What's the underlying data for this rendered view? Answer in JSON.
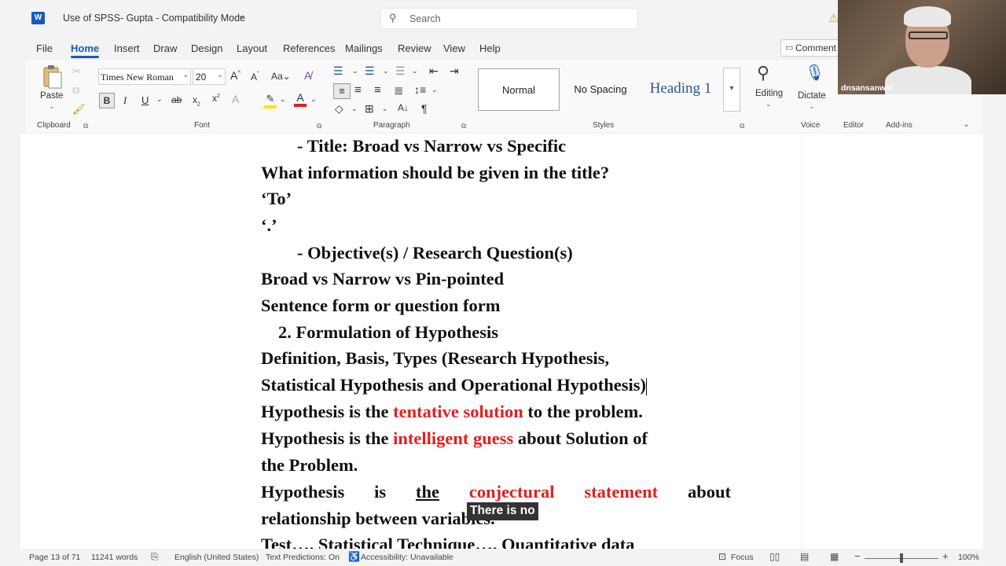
{
  "titlebar": {
    "app_icon": "W",
    "doc_title": "Use of SPSS- Gupta  -  Compatibility Mode",
    "search_placeholder": "Search"
  },
  "menu": {
    "tabs": [
      "File",
      "Home",
      "Insert",
      "Draw",
      "Design",
      "Layout",
      "References",
      "Mailings",
      "Review",
      "View",
      "Help"
    ],
    "active": "Home",
    "comments_label": "Comment"
  },
  "ribbon": {
    "paste_label": "Paste",
    "font_name": "Times New Roman",
    "font_size": "20",
    "groups": {
      "clipboard": "Clipboard",
      "font": "Font",
      "paragraph": "Paragraph",
      "styles": "Styles",
      "voice": "Voice",
      "editor": "Editor",
      "addins": "Add-ins"
    },
    "styles": [
      "Normal",
      "No Spacing",
      "Heading 1"
    ],
    "editing_label": "Editing",
    "dictate_label": "Dictate",
    "editor_label": "Editor",
    "addins_label": "Add-ins"
  },
  "document": {
    "lines": {
      "l1": "-   Title: Broad vs Narrow vs Specific",
      "l2": "What information should be given in the title?",
      "l3": "‘To’",
      "l4": "‘.’",
      "l5": "-   Objective(s) / Research Question(s)",
      "l6": "Broad vs Narrow vs Pin-pointed",
      "l7": "Sentence form or question form",
      "l8": "2. Formulation of Hypothesis",
      "l9": "Definition, Basis, Types (Research Hypothesis,",
      "l10": "Statistical Hypothesis and Operational Hypothesis)",
      "l11a": "Hypothesis is the ",
      "l11b": "tentative solution",
      "l11c": " to the problem.",
      "l12a": "Hypothesis is the ",
      "l12b": "intelligent guess",
      "l12c": " about Solution of",
      "l13": "the Problem.",
      "l14": [
        "Hypothesis",
        "is",
        "the",
        "conjectural",
        "statement",
        "about"
      ],
      "l15": "relationship between variables.",
      "l16": "Test…. Statistical Technique…. Quantitative data"
    },
    "highlight_color": "#e02020"
  },
  "caption": "There is no",
  "statusbar": {
    "page": "Page 13 of 71",
    "words": "11241 words",
    "language": "English (United States)",
    "predictions": "Text Predictions: On",
    "accessibility": "Accessibility: Unavailable",
    "focus": "Focus",
    "zoom": "100%",
    "zoom_level": 1.0
  },
  "webcam": {
    "name": "dnsansanwal"
  }
}
